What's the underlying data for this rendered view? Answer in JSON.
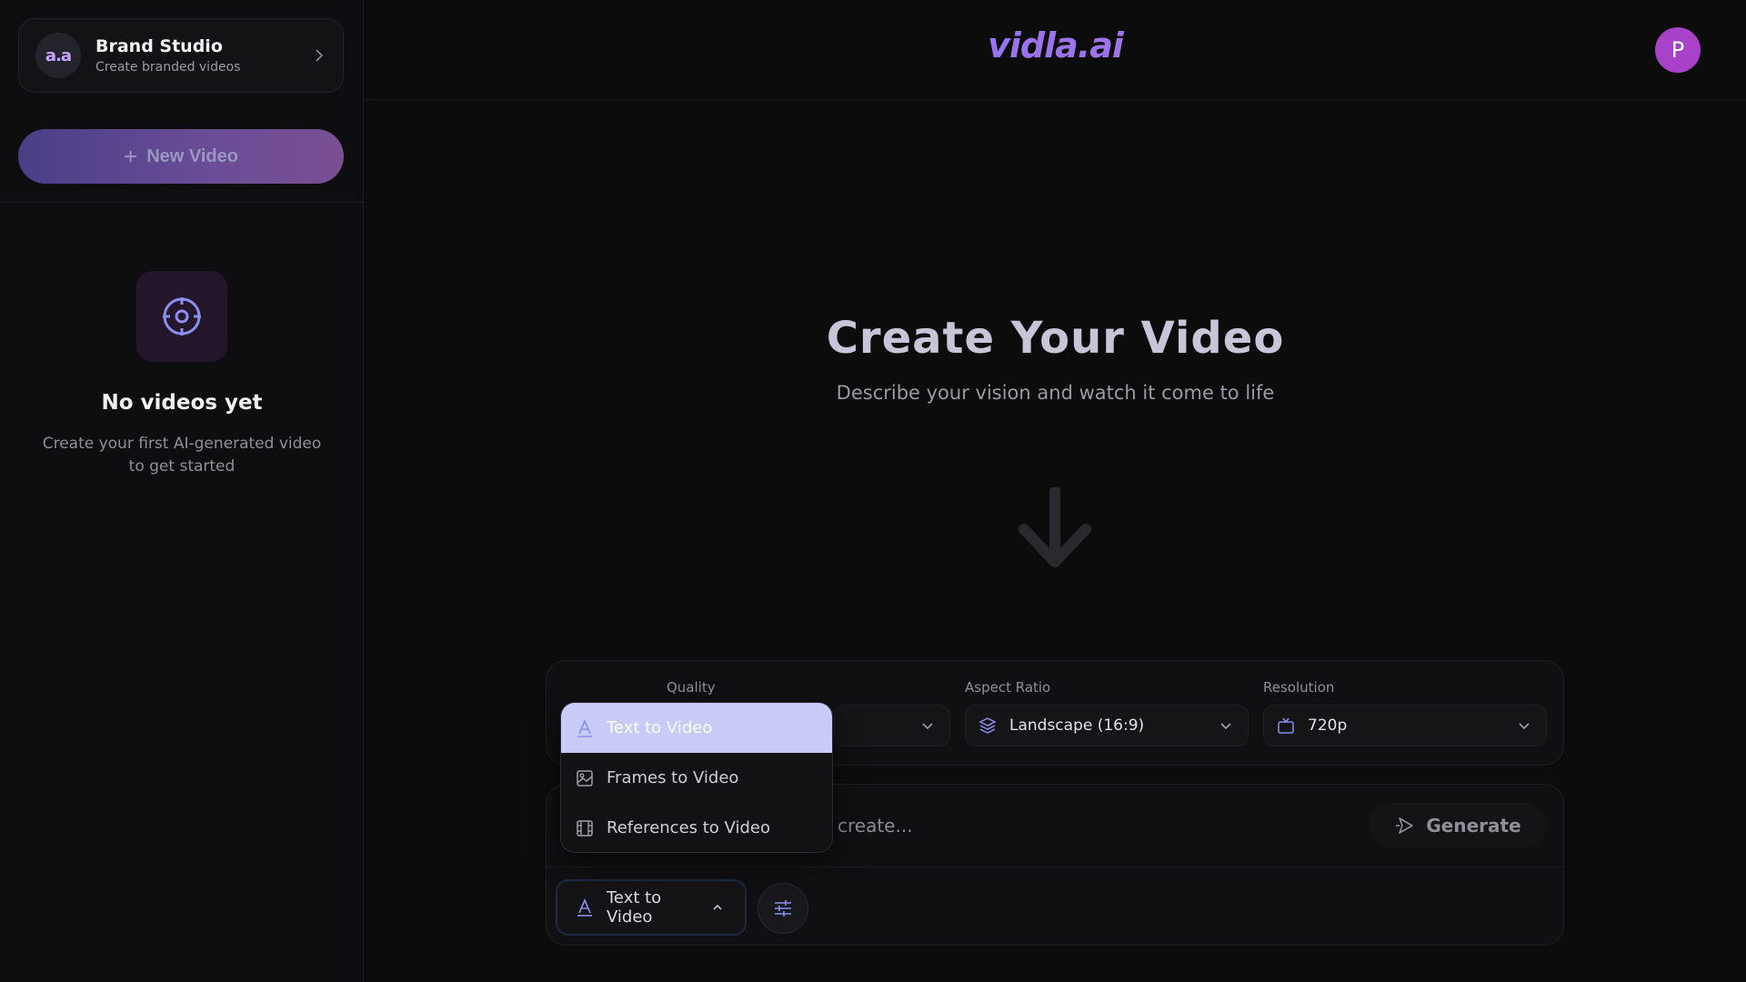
{
  "sidebar": {
    "brand": {
      "logo_text": "a.a",
      "title": "Brand Studio",
      "subtitle": "Create branded videos"
    },
    "new_video_label": "New Video",
    "empty": {
      "title": "No videos yet",
      "description": "Create your first AI-generated video to get started"
    }
  },
  "header": {
    "logo": "vidla.ai",
    "avatar_initial": "P"
  },
  "hero": {
    "title": "Create Your Video",
    "subtitle": "Describe your vision and watch it come to life"
  },
  "settings": {
    "quality": {
      "label": "Quality"
    },
    "aspect_ratio": {
      "label": "Aspect Ratio",
      "value": "Landscape (16:9)"
    },
    "resolution": {
      "label": "Resolution",
      "value": "720p"
    }
  },
  "prompt": {
    "placeholder": "create...",
    "generate_label": "Generate",
    "mode_value": "Text to Video"
  },
  "mode_menu": {
    "items": [
      {
        "label": "Text to Video",
        "icon": "text-a-icon",
        "selected": true
      },
      {
        "label": "Frames to Video",
        "icon": "image-icon",
        "selected": false
      },
      {
        "label": "References to Video",
        "icon": "film-icon",
        "selected": false
      }
    ]
  },
  "colors": {
    "accent_gradient_start": "#6e7bff",
    "accent_gradient_end": "#c86bd8",
    "avatar": "#a843c9",
    "menu_selected": "#c7cbf6",
    "icon_accent": "#8b8ff0"
  }
}
